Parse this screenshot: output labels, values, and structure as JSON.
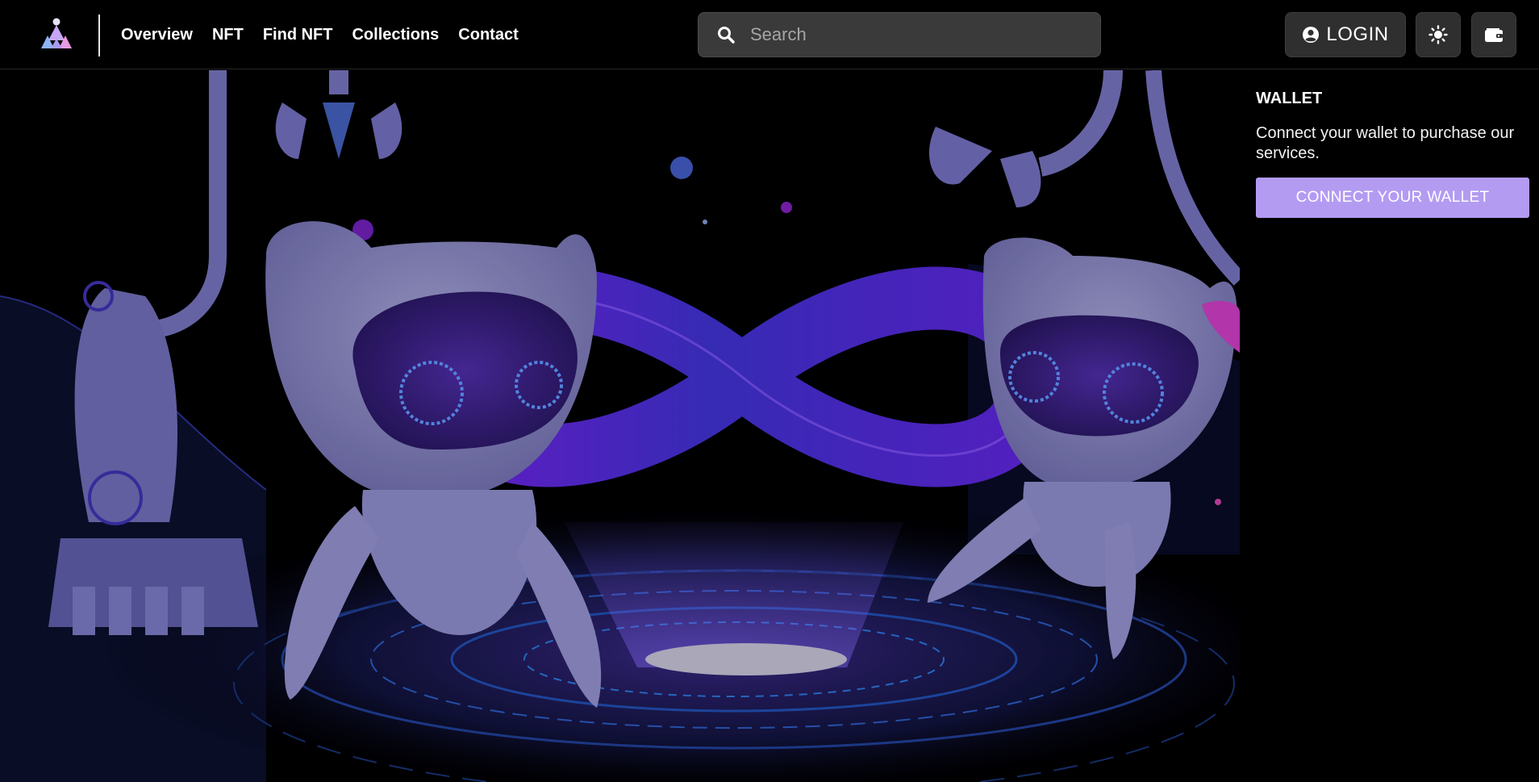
{
  "header": {
    "logo_icon": "triangle-logo-icon",
    "nav": [
      "Overview",
      "NFT",
      "Find NFT",
      "Collections",
      "Contact"
    ],
    "search": {
      "placeholder": "Search",
      "icon": "search-icon"
    },
    "login_label": "LOGIN",
    "login_icon": "user-circle-icon",
    "theme_icon": "sun-icon",
    "wallet_icon": "wallet-icon"
  },
  "hero": {
    "image": "nft-robots-infinity-illustration"
  },
  "wallet": {
    "title": "WALLET",
    "description": "Connect your wallet to purchase our services.",
    "button_label": "CONNECT YOUR WALLET"
  },
  "colors": {
    "background": "#000000",
    "accent": "#b39bf2",
    "button_bg": "#2f2f2f",
    "search_bg": "#3a3a3a"
  }
}
